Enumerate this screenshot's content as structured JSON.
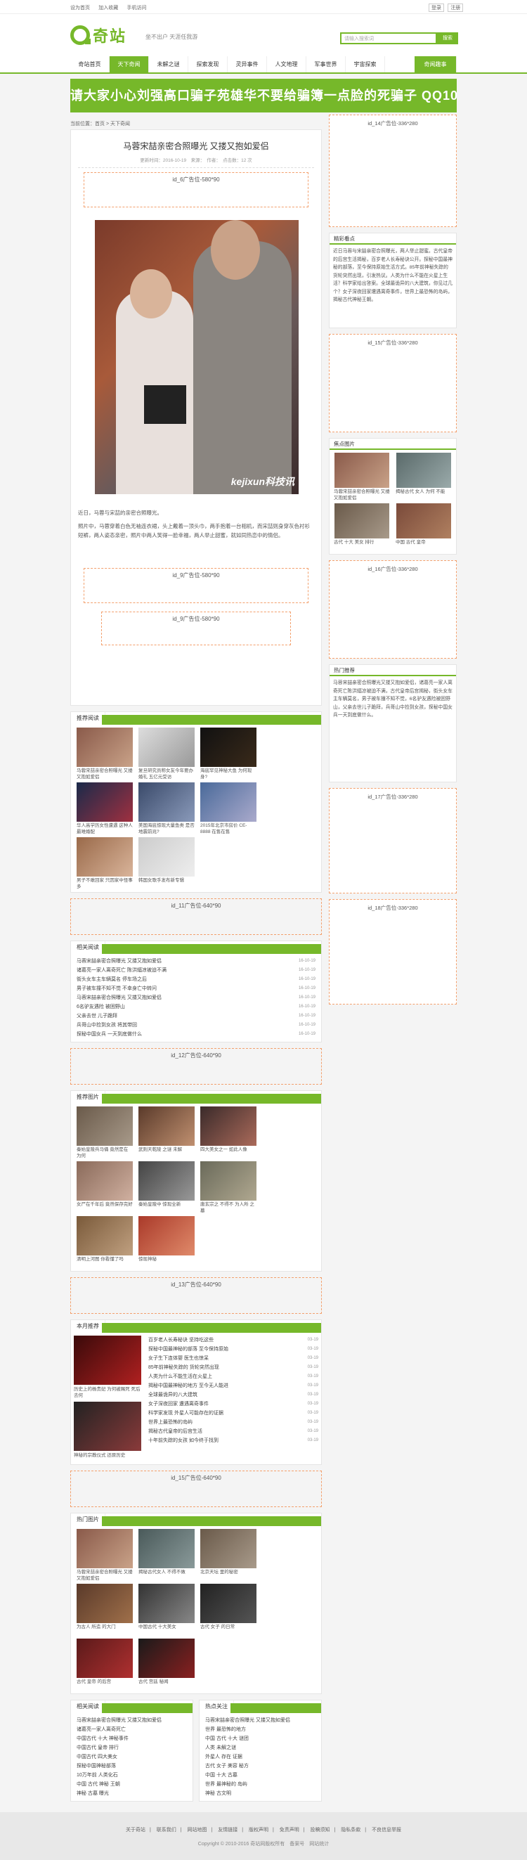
{
  "topbar": {
    "links": [
      "设为首页",
      "加入收藏",
      "手机访问"
    ],
    "right": [
      "登录",
      "注册"
    ]
  },
  "header": {
    "logo": "奇站",
    "slogan": "坐不出户 天涯任我游",
    "search_placeholder": "请输入搜索词",
    "search_btn": "搜索"
  },
  "nav": [
    "奇站首页",
    "天下奇闻",
    "未解之谜",
    "探索发现",
    "灵异事件",
    "人文地理",
    "军事世界",
    "宇宙探索"
  ],
  "nav_highlight": "奇闻趣事",
  "banner": "请大家小心刘强高口骗子苑雄华不要给骗簿一点脸的死骗子 QQ1094028072",
  "crumb": "当前位置：首页 > 天下奇闻",
  "article": {
    "title": "马蓉宋喆亲密合照曝光 又搂又抱如爱侣",
    "meta": "更新时间：2016-10-19　来源：　作者：　点击数：12 次",
    "ad1": "id_6广告位-580*90",
    "watermark": "kejixun科技讯",
    "p1": "近日，马蓉与宋喆的亲密合照曝光。",
    "p2": "照片中，马蓉穿着白色无袖连衣裙，头上戴着一顶头巾，两手抱着一台相机，而宋喆则身穿灰色衬衫短裤，两人姿态亲密，照片中两人笑得一脸幸福，两人举止甜蜜，就如同热恋中的情侣。",
    "ad2": "id_9广告位-580*90",
    "ad3": "id_9广告位-580*90"
  },
  "recommend": {
    "title": "推荐阅读",
    "items": [
      "马蓉宋喆亲密合照曝光 又搂又抱如爱侣",
      "复旦研究员称女友今年要办婚礼 五亿元受访",
      "海底罕见神秘大鱼 为何现身?",
      "华人高学历女性遭遇 这种人最难婚配",
      "美国海底惊现大量鱼类 是否地震前兆?",
      "2015年北京市房价 CE-8888 在售在售",
      "男子不敢回家 只因家中怪事多",
      "韩国女歌手发布新专辑"
    ]
  },
  "ad11": "id_11广告位-640*90",
  "related": {
    "title": "相关阅读",
    "items": [
      {
        "t": "马蓉宋喆亲密合照曝光 又搂又抱如爱侣",
        "d": "16-10-19"
      },
      {
        "t": "诸葛亮一家人离奇死亡 陈洪辐凉被迫不满",
        "d": "16-10-19"
      },
      {
        "t": "街头女车主车辆莫名 停车场之后",
        "d": "16-10-19"
      },
      {
        "t": "男子被车撞不知不觉 不幸身亡中转问",
        "d": "16-10-19"
      },
      {
        "t": "马蓉宋喆亲密合照曝光 又搂又抱如爱侣",
        "d": "16-10-19"
      },
      {
        "t": "6名驴友遇险 被困野山",
        "d": "16-10-19"
      },
      {
        "t": "父亲去世 儿子跪拜",
        "d": "16-10-19"
      },
      {
        "t": "兵哥山中捡到女孩 将其带回",
        "d": "16-10-19"
      },
      {
        "t": "探秘中国女兵 一天到底做什么",
        "d": "16-10-19"
      }
    ]
  },
  "ad12": "id_12广告位-640*90",
  "photos": {
    "title": "推荐图片",
    "items": [
      "秦始皇陵兵马俑 竟然是在 为何",
      "武则天乾陵 之谜 未解",
      "四大美女之一 如此人像",
      "女尸在千年后 竟然保存完好",
      "秦始皇陵中 惊现全新",
      "唐玄宗之 不得不 为人所 之墓",
      "清明上河图 你看懂了吗",
      "惊现神秘"
    ]
  },
  "ad13": "id_13广告位-640*90",
  "monthly": {
    "title": "本月推荐",
    "left": [
      "历史上的杨贵妃 为何被赐死 死后去何",
      "神秘的宗教仪式 还原历史"
    ],
    "items": [
      {
        "t": "百岁老人长寿秘诀 坚持吃这些",
        "d": "03-19"
      },
      {
        "t": "探秘中国最神秘的部落 至今保持原始",
        "d": "03-19"
      },
      {
        "t": "女子生下连体婴 医生也惊呆",
        "d": "03-19"
      },
      {
        "t": "85年前神秘失踪的 货轮突然出现",
        "d": "03-19"
      },
      {
        "t": "人类为什么不能生活在火星上",
        "d": "03-19"
      },
      {
        "t": "揭秘中国最神秘的地方 至今无人能进",
        "d": "03-19"
      },
      {
        "t": "全球最诡异的八大建筑",
        "d": "03-19"
      },
      {
        "t": "女子深夜回家 遭遇离奇事件",
        "d": "03-19"
      },
      {
        "t": "科学家发现 外星人可能存在的证据",
        "d": "03-19"
      },
      {
        "t": "世界上最恐怖的岛屿",
        "d": "03-19"
      },
      {
        "t": "揭秘古代皇帝的后宫生活",
        "d": "03-19"
      },
      {
        "t": "十年前失踪的女孩 如今终于找到",
        "d": "03-19"
      }
    ]
  },
  "ad15": "id_15广告位-640*90",
  "hotpics": {
    "title": "热门图片",
    "items": [
      "马蓉宋喆亲密合照曝光 又搂又抱如爱侣",
      "揭秘古代女人 不得不做",
      "北京天坛 里的秘密",
      "为古人 所造 的大门",
      "中国古代 十大美女",
      "古代 女子 的日常",
      "古代 皇帝 的后宫",
      "古代 宫廷 秘闻"
    ]
  },
  "bottom": {
    "left": {
      "title": "相关阅读",
      "items": [
        "马蓉宋喆亲密合照曝光 又搂又抱如爱侣",
        "诸葛亮一家人离奇死亡",
        "中国古代 十大 神秘事件",
        "中国古代 皇帝 排行",
        "中国古代 四大美女",
        "探秘中国神秘部落",
        "10万年前 人类化石",
        "中国 古代 神秘 王朝",
        "神秘 古墓 曝光"
      ]
    },
    "right": {
      "title": "热点关注",
      "items": [
        "马蓉宋喆亲密合照曝光 又搂又抱如爱侣",
        "世界 最恐怖的地方",
        "中国 古代 十大 谜团",
        "人类 未解之谜",
        "外星人 存在 证据",
        "古代 女子 美容 秘方",
        "中国 十大 古墓",
        "世界 最神秘的 岛屿",
        "神秘 古文明"
      ]
    }
  },
  "side": {
    "ad14": "id_14广告位-336*280",
    "news": {
      "title": "精彩看点",
      "text": "近日马蓉与宋喆亲密合照曝光，两人举止甜蜜。古代皇帝的后宫生活揭秘，百岁老人长寿秘诀公开。探秘中国最神秘的部落，至今保持原始生活方式。85年前神秘失踪的货轮突然出现，引发热议。人类为什么不能在火星上生活？科学家给出答案。全球最诡异的八大建筑，你见过几个？女子深夜回家遭遇离奇事件，世界上最恐怖的岛屿，揭秘古代神秘王朝。"
    },
    "ad15": "id_15广告位-336*280",
    "pics": {
      "title": "焦点图片",
      "items": [
        "马蓉宋喆亲密合照曝光 又搂又抱如爱侣",
        "揭秘古代 女人 为何 不能",
        "古代 十大 美女 排行",
        "中国 古代 皇帝"
      ]
    },
    "ad16": "id_16广告位-336*280",
    "hot": {
      "title": "热门推荐",
      "text": "马蓉宋喆亲密合照曝光又搂又抱如爱侣，诸葛亮一家人离奇死亡陈洪辐凉被迫不满，古代皇帝后宫揭秘，街头女车主车辆莫名，男子被车撞不知不觉，6名驴友遇险被困野山，父亲去世儿子跪拜，兵哥山中捡到女孩，探秘中国女兵一天到底做什么。"
    },
    "ad17": "id_17广告位-336*280",
    "ad18": "id_18广告位-336*280"
  },
  "footer": {
    "links": [
      "关于奇站",
      "联系我们",
      "网站地图",
      "友情链接",
      "版权声明",
      "免责声明",
      "投稿须知",
      "隐私条款",
      "不良信息举报"
    ],
    "copy": "Copyright © 2010-2016 奇站网版权所有　备案号　网站统计"
  }
}
